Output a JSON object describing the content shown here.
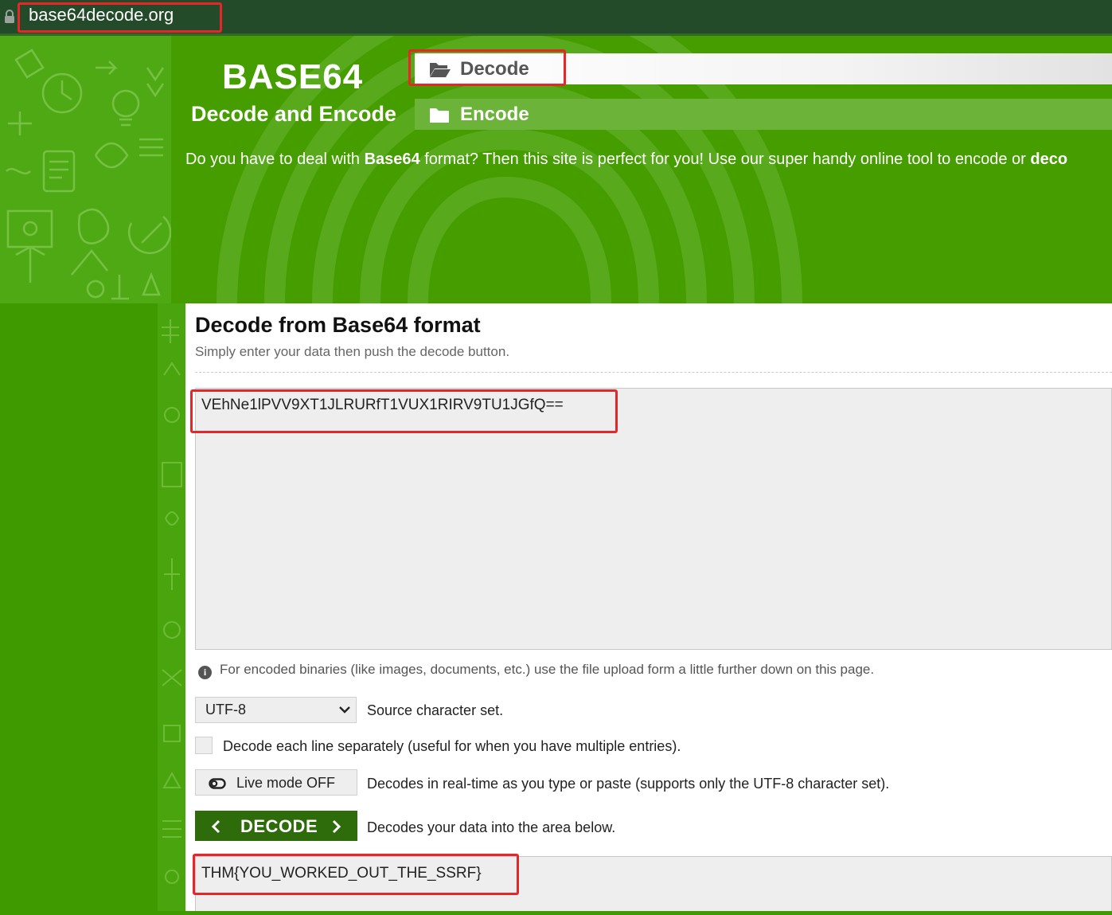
{
  "browser": {
    "url": "base64decode.org"
  },
  "site": {
    "logo_title": "BASE64",
    "logo_subtitle": "Decode and Encode",
    "tabs": [
      {
        "label": "Decode",
        "icon": "folder-open-icon",
        "active": true
      },
      {
        "label": "Encode",
        "icon": "folder-icon",
        "active": false
      }
    ],
    "tagline_pre": "Do you have to deal with ",
    "tagline_bold": "Base64",
    "tagline_mid": " format? Then this site is perfect for you! Use our super handy online tool to encode or ",
    "tagline_bold2": "deco"
  },
  "decode_form": {
    "title": "Decode from Base64 format",
    "subtitle": "Simply enter your data then push the decode button.",
    "input_value": "VEhNe1lPVV9XT1JLRURfT1VUX1RIRV9TU1JGfQ==",
    "info_text": "For encoded binaries (like images, documents, etc.) use the file upload form a little further down on this page.",
    "charset_value": "UTF-8",
    "charset_label": "Source character set.",
    "line_checkbox_label": "Decode each line separately (useful for when you have multiple entries).",
    "line_checkbox_checked": false,
    "live_mode_label": "Live mode OFF",
    "live_mode_desc": "Decodes in real-time as you type or paste (supports only the UTF-8 character set).",
    "decode_button_label": "DECODE",
    "decode_button_desc": "Decodes your data into the area below.",
    "output_value": "THM{YOU_WORKED_OUT_THE_SSRF}"
  },
  "colors": {
    "brand_green": "#459d00",
    "dark_green_button": "#2e6b0a",
    "highlight_red": "#e8262a"
  }
}
